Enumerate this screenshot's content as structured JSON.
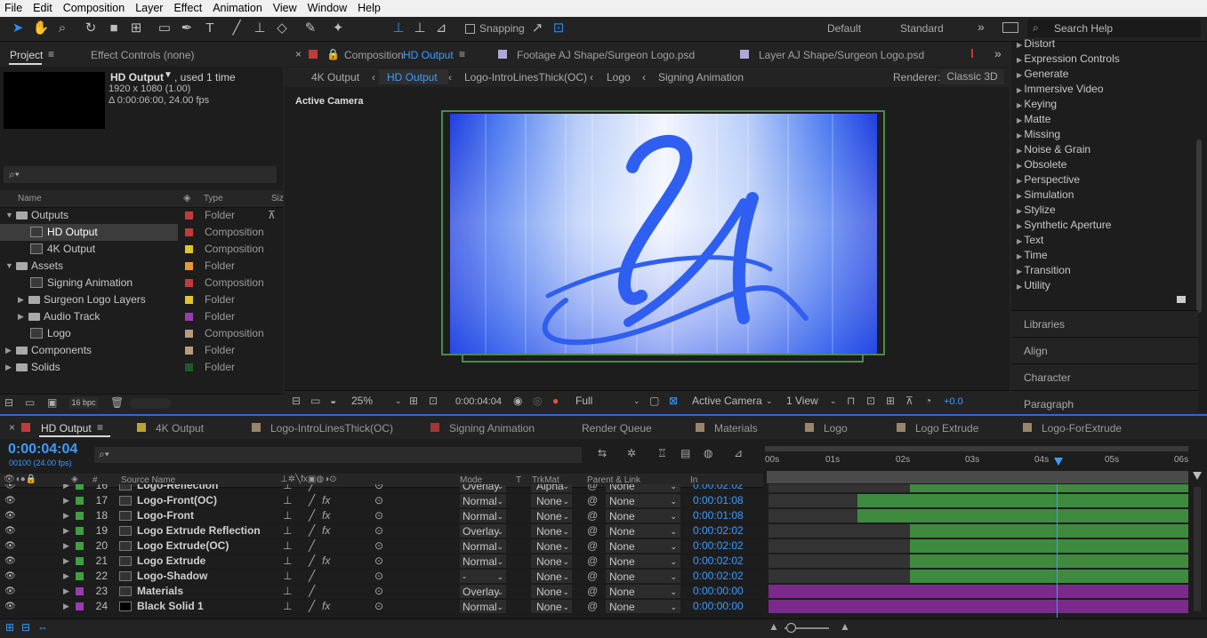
{
  "menu": [
    "File",
    "Edit",
    "Composition",
    "Layer",
    "Effect",
    "Animation",
    "View",
    "Window",
    "Help"
  ],
  "toolbar": {
    "snapping": "Snapping",
    "workspace_default": "Default",
    "workspace_standard": "Standard",
    "search_placeholder": "Search Help"
  },
  "project": {
    "tab_project": "Project",
    "tab_effect_controls": "Effect Controls (none)",
    "selected_name": "HD Output",
    "selected_used": ", used 1 time",
    "selected_res": "1920 x 1080 (1.00)",
    "selected_dur": "Δ 0:00:06:00, 24.00 fps",
    "col_name": "Name",
    "col_type": "Type",
    "col_size": "Siz",
    "items": [
      {
        "name": "Outputs",
        "type": "Folder",
        "color": "#c23b3b",
        "kind": "folder",
        "indent": 0,
        "open": true
      },
      {
        "name": "HD Output",
        "type": "Composition",
        "color": "#c23b3b",
        "kind": "comp",
        "indent": 1,
        "selected": true
      },
      {
        "name": "4K Output",
        "type": "Composition",
        "color": "#e0c52e",
        "kind": "comp",
        "indent": 1
      },
      {
        "name": "Assets",
        "type": "Folder",
        "color": "#e89a2c",
        "kind": "folder",
        "indent": 0,
        "open": true
      },
      {
        "name": "Signing Animation",
        "type": "Composition",
        "color": "#c23b3b",
        "kind": "comp",
        "indent": 1
      },
      {
        "name": "Surgeon Logo Layers",
        "type": "Folder",
        "color": "#e0c52e",
        "kind": "folder",
        "indent": 1
      },
      {
        "name": "Audio Track",
        "type": "Folder",
        "color": "#9b3bb0",
        "kind": "folder",
        "indent": 1
      },
      {
        "name": "Logo",
        "type": "Composition",
        "color": "#b79d7d",
        "kind": "comp",
        "indent": 1
      },
      {
        "name": "Components",
        "type": "Folder",
        "color": "#b79d7d",
        "kind": "folder",
        "indent": 0
      },
      {
        "name": "Solids",
        "type": "Folder",
        "color": "#1e5a2a",
        "kind": "folder",
        "indent": 0
      }
    ],
    "bpc": "16 bpc"
  },
  "viewer": {
    "tab_comp_prefix": "Composition",
    "tab_comp_name": "HD Output",
    "tab_footage": "Footage AJ Shape/Surgeon Logo.psd",
    "tab_layer": "Layer AJ Shape/Surgeon Logo.psd",
    "breadcrumbs": [
      "4K Output",
      "HD Output",
      "Logo-IntroLinesThick(OC)",
      "Logo",
      "Signing Animation"
    ],
    "renderer_label": "Renderer:",
    "renderer_value": "Classic 3D",
    "active_camera": "Active Camera",
    "zoom": "25%",
    "timecode": "0:00:04:04",
    "resolution": "Full",
    "camera": "Active Camera",
    "views": "1 View",
    "exposure": "+0.0"
  },
  "effects": {
    "items": [
      "Distort",
      "Expression Controls",
      "Generate",
      "Immersive Video",
      "Keying",
      "Matte",
      "Missing",
      "Noise & Grain",
      "Obsolete",
      "Perspective",
      "Simulation",
      "Stylize",
      "Synthetic Aperture",
      "Text",
      "Time",
      "Transition",
      "Utility"
    ],
    "panels": [
      "Libraries",
      "Align",
      "Character",
      "Paragraph"
    ]
  },
  "timeline": {
    "tabs": [
      {
        "label": "HD Output",
        "color": "#c23b3b",
        "active": true
      },
      {
        "label": "4K Output",
        "color": "#e0c52e"
      },
      {
        "label": "Logo-IntroLinesThick(OC)",
        "color": "#b79d7d"
      },
      {
        "label": "Signing Animation",
        "color": "#c23b3b"
      },
      {
        "label": "Render Queue",
        "color": ""
      },
      {
        "label": "Materials",
        "color": "#b79d7d"
      },
      {
        "label": "Logo",
        "color": "#b79d7d"
      },
      {
        "label": "Logo Extrude",
        "color": "#b79d7d"
      },
      {
        "label": "Logo-ForExtrude",
        "color": "#b79d7d"
      }
    ],
    "timecode": "0:00:04:04",
    "frames": "00100 (24.00 fps)",
    "col_source": "Source Name",
    "col_mode": "Mode",
    "col_t": "T",
    "col_trkmat": "TrkMat",
    "col_parent": "Parent & Link",
    "col_in": "In",
    "ruler": [
      "00s",
      "01s",
      "02s",
      "03s",
      "04s",
      "05s",
      "06s"
    ],
    "layers": [
      {
        "num": "16",
        "name": "Logo-Reflection",
        "mode": "Overlay",
        "trk": "Alpha",
        "parent": "None",
        "in": "0:00:02:02",
        "color": "#3fa03f",
        "partial": true
      },
      {
        "num": "17",
        "name": "Logo-Front(OC)",
        "mode": "Normal",
        "trk": "None",
        "parent": "None",
        "in": "0:00:01:08",
        "color": "#3fa03f",
        "fx": true
      },
      {
        "num": "18",
        "name": "Logo-Front",
        "mode": "Normal",
        "trk": "None",
        "parent": "None",
        "in": "0:00:01:08",
        "color": "#3fa03f",
        "fx": true
      },
      {
        "num": "19",
        "name": "Logo Extrude Reflection",
        "mode": "Overlay",
        "trk": "None",
        "parent": "None",
        "in": "0:00:02:02",
        "color": "#3fa03f",
        "fx": true
      },
      {
        "num": "20",
        "name": "Logo Extrude(OC)",
        "mode": "Normal",
        "trk": "None",
        "parent": "None",
        "in": "0:00:02:02",
        "color": "#3fa03f"
      },
      {
        "num": "21",
        "name": "Logo Extrude",
        "mode": "Normal",
        "trk": "None",
        "parent": "None",
        "in": "0:00:02:02",
        "color": "#3fa03f",
        "fx": true
      },
      {
        "num": "22",
        "name": "Logo-Shadow",
        "mode": "-",
        "trk": "None",
        "parent": "None",
        "in": "0:00:02:02",
        "color": "#3fa03f"
      },
      {
        "num": "23",
        "name": "Materials",
        "mode": "Overlay",
        "trk": "None",
        "parent": "None",
        "in": "0:00:00:00",
        "color": "#9b3bb0"
      },
      {
        "num": "24",
        "name": "Black Solid 1",
        "mode": "Normal",
        "trk": "None",
        "parent": "None",
        "in": "0:00:00:00",
        "color": "#9b3bb0",
        "fx": true
      }
    ]
  }
}
